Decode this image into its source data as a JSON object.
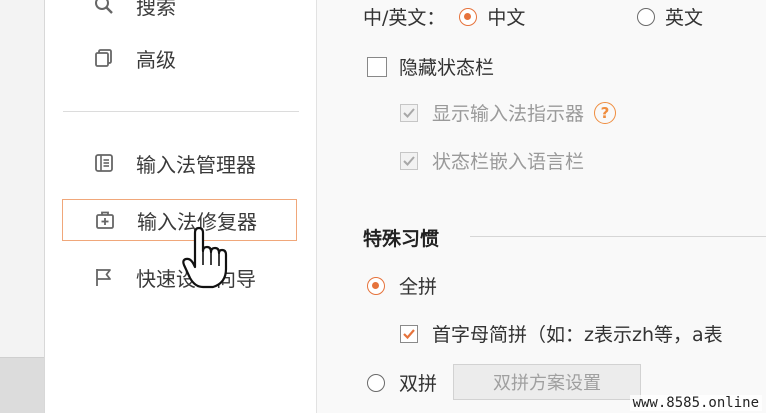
{
  "sidebar": {
    "items": [
      {
        "label": "搜索",
        "icon": "search-icon"
      },
      {
        "label": "高级",
        "icon": "advanced-icon"
      },
      {
        "label": "输入法管理器",
        "icon": "manager-icon"
      },
      {
        "label": "输入法修复器",
        "icon": "repair-icon",
        "selected": true
      },
      {
        "label": "快速设置向导",
        "icon": "flag-icon"
      }
    ]
  },
  "main": {
    "lang_label": "中/英文：",
    "lang_options": [
      {
        "label": "中文",
        "selected": true
      },
      {
        "label": "英文",
        "selected": false
      }
    ],
    "hide_statusbar": {
      "label": "隐藏状态栏",
      "checked": false
    },
    "show_indicator": {
      "label": "显示输入法指示器",
      "checked": true,
      "disabled": true
    },
    "help_symbol": "?",
    "embed_langbar": {
      "label": "状态栏嵌入语言栏",
      "checked": true,
      "disabled": true
    },
    "section_title": "特殊习惯",
    "pinyin_full": {
      "label": "全拼",
      "selected": true
    },
    "initials": {
      "label": "首字母简拼（如：z表示zh等，a表",
      "checked": true
    },
    "pinyin_double": {
      "label": "双拼",
      "selected": false
    },
    "double_scheme_button": "双拼方案设置"
  },
  "colors": {
    "accent": "#e6733c",
    "selection_border": "#f0a77a"
  },
  "watermark": "www.8585.online"
}
